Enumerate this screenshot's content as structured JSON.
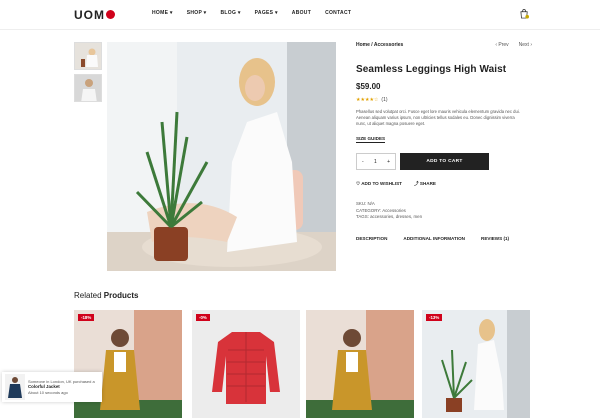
{
  "header": {
    "logo": "UOM",
    "nav": [
      "HOME",
      "SHOP",
      "BLOG",
      "PAGES",
      "ABOUT",
      "CONTACT"
    ],
    "dropdown_items": [
      true,
      true,
      true,
      true,
      false,
      false
    ]
  },
  "product": {
    "breadcrumb": "Home / Accessories",
    "prev": "Prev",
    "next": "Next",
    "title": "Seamless Leggings High Waist",
    "price": "$59.00",
    "reviews_count": "(1)",
    "rating": 4,
    "description": "Phasellus sed volutpat orci. Fusce eget lore mauris vehicula elementum gravida nec dui. Aenean aliquam varius ipsum, non ultricies tellus sodales eu. Donec dignissim viverra nunc, ut aliquet magna posuere eget.",
    "size_guide": "SIZE GUIDES",
    "quantity": "1",
    "qty_minus": "-",
    "qty_plus": "+",
    "add_to_cart": "ADD TO CART",
    "wishlist": "ADD TO WISHLIST",
    "share": "SHARE",
    "sku": "SKU: N/A",
    "category": "CATEGORY: Accessories",
    "tags": "TAGS: accessories, dresses, men",
    "tabs": [
      "DESCRIPTION",
      "ADDITIONAL INFORMATION",
      "REVIEWS (1)"
    ]
  },
  "related": {
    "heading_prefix": "Related ",
    "heading_strong": "Products",
    "badges": [
      "-18%",
      "-0%",
      "-13%"
    ]
  },
  "toast": {
    "line1": "Someone in London, UK purchased a",
    "product": "Colorful Jacket",
    "time": "About 10 seconds ago"
  },
  "colors": {
    "accent": "#d0021b",
    "dark": "#222222",
    "star": "#e2a100"
  }
}
